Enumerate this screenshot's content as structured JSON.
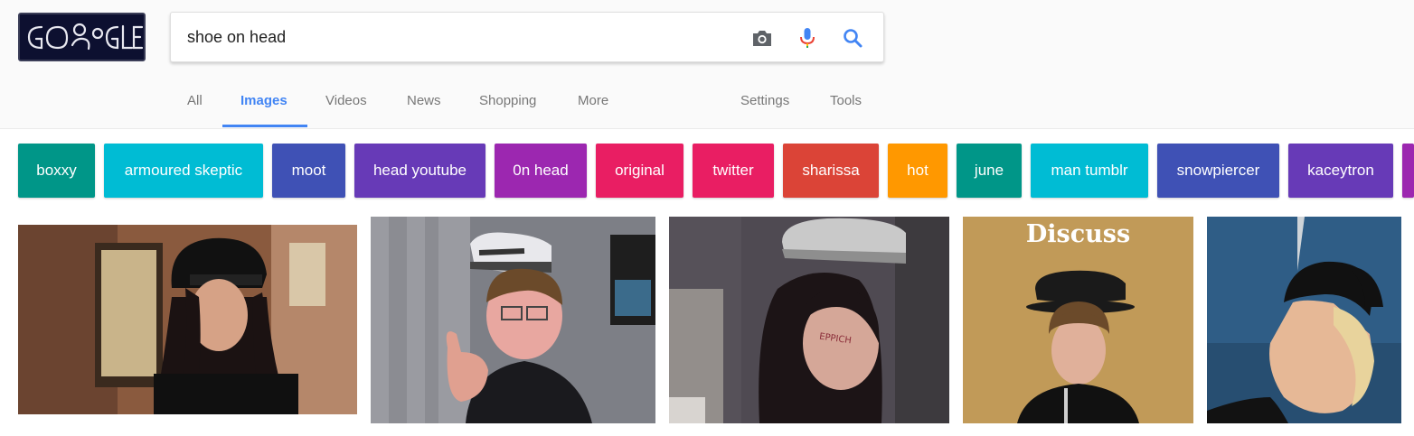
{
  "logo": {
    "text": "GOOGLE",
    "icon": "doodle-logo-icon"
  },
  "search": {
    "query": "shoe on head",
    "placeholder": "",
    "icons": [
      "camera-icon",
      "mic-icon",
      "search-icon"
    ]
  },
  "tabs": {
    "items": [
      {
        "label": "All"
      },
      {
        "label": "Images"
      },
      {
        "label": "Videos"
      },
      {
        "label": "News"
      },
      {
        "label": "Shopping"
      },
      {
        "label": "More"
      },
      {
        "label": "Settings"
      },
      {
        "label": "Tools"
      }
    ],
    "active": "Images",
    "accent_color": "#4285f4"
  },
  "chips": [
    {
      "label": "boxxy",
      "color": "#009688"
    },
    {
      "label": "armoured skeptic",
      "color": "#00bcd4"
    },
    {
      "label": "moot",
      "color": "#3f51b5"
    },
    {
      "label": "head youtube",
      "color": "#673ab7"
    },
    {
      "label": "0n head",
      "color": "#9c27b0"
    },
    {
      "label": "original",
      "color": "#e91e63"
    },
    {
      "label": "twitter",
      "color": "#e91e63"
    },
    {
      "label": "sharissa",
      "color": "#db4437"
    },
    {
      "label": "hot",
      "color": "#ff9800"
    },
    {
      "label": "june",
      "color": "#009688"
    },
    {
      "label": "man tumblr",
      "color": "#00bcd4"
    },
    {
      "label": "snowpiercer",
      "color": "#3f51b5"
    },
    {
      "label": "kaceytron",
      "color": "#673ab7"
    },
    {
      "label": "",
      "color": "#9c27b0"
    }
  ],
  "results": {
    "thumbnails": [
      {
        "name": "woman-police-hat"
      },
      {
        "name": "man-shoe-on-head-thumbs-up"
      },
      {
        "name": "girl-shoe-on-head"
      },
      {
        "name": "boy-shoe-on-head",
        "overlay_text": "Discuss"
      },
      {
        "name": "woman-futuristic-headgear"
      }
    ],
    "cheek_text": "EPPICH"
  }
}
